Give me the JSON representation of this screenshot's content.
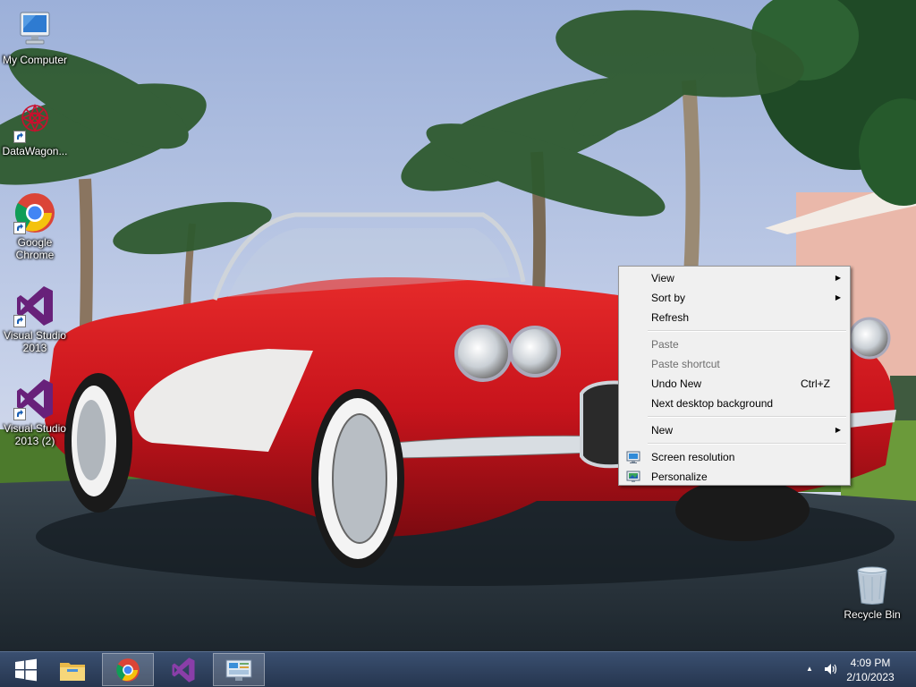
{
  "desktop": {
    "icons": [
      {
        "label": "My Computer",
        "icon": "computer-icon",
        "shortcut": false
      },
      {
        "label": "DataWagon...",
        "icon": "datawagon-icon",
        "shortcut": true
      },
      {
        "label": "Google\nChrome",
        "icon": "chrome-icon",
        "shortcut": true
      },
      {
        "label": "Visual Studio\n2013",
        "icon": "visual-studio-icon",
        "shortcut": true
      },
      {
        "label": "Visual Studio\n2013 (2)",
        "icon": "visual-studio-icon",
        "shortcut": true
      },
      {
        "label": "Recycle Bin",
        "icon": "recycle-bin-icon",
        "shortcut": false
      }
    ]
  },
  "context_menu": {
    "items": {
      "view": "View",
      "sort_by": "Sort by",
      "refresh": "Refresh",
      "paste": "Paste",
      "paste_shortcut": "Paste shortcut",
      "undo_new": "Undo New",
      "undo_new_accel": "Ctrl+Z",
      "next_background": "Next desktop background",
      "new": "New",
      "screen_resolution": "Screen resolution",
      "personalize": "Personalize"
    },
    "disabled": [
      "Paste",
      "Paste shortcut"
    ],
    "submenu_arrow": "▶"
  },
  "taskbar": {
    "buttons": [
      "start-icon",
      "file-explorer-icon",
      "chrome-icon",
      "visual-studio-icon",
      "control-panel-icon"
    ],
    "active": [
      "chrome-icon",
      "control-panel-icon"
    ],
    "tray": {
      "show_hidden": "▲",
      "time": "4:09 PM",
      "date": "2/10/2023"
    }
  },
  "colors": {
    "taskbar": "#2b3c57",
    "menu_bg": "#f0f0f0",
    "vs_purple": "#68217a",
    "car_red": "#c8141c"
  }
}
